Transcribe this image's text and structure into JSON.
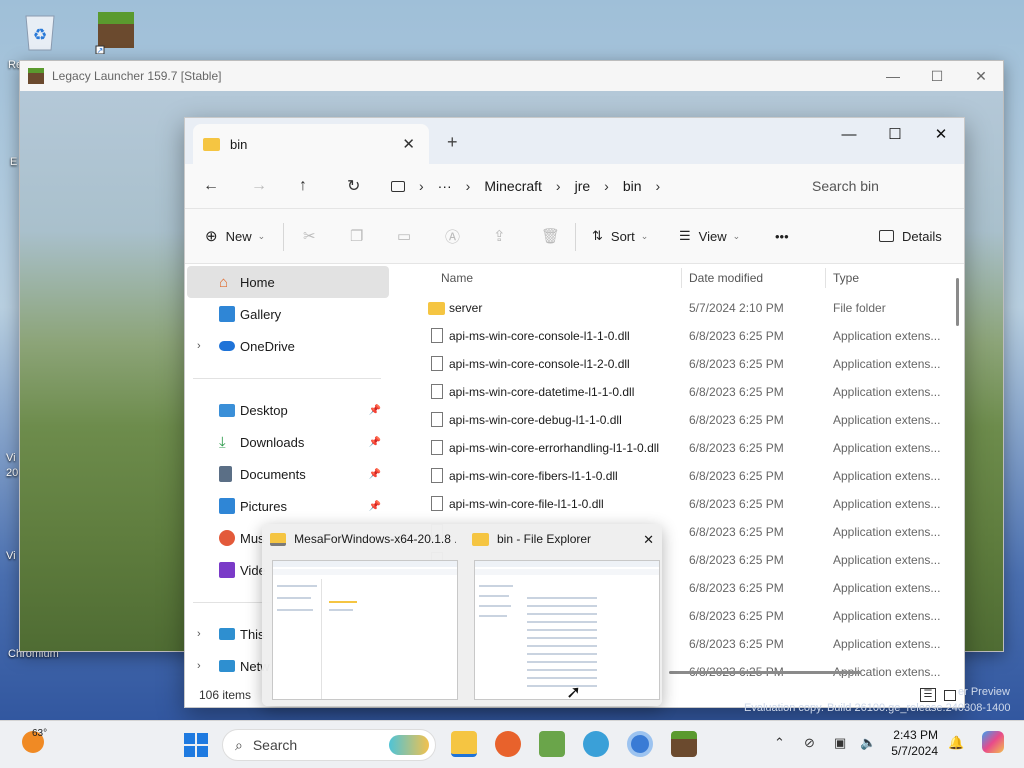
{
  "desktop": {
    "icons": [
      {
        "name": "recycle-bin",
        "label": "Re"
      },
      {
        "name": "minecraft",
        "label": ""
      }
    ],
    "side_labels": [
      "E",
      "Vi",
      "20",
      "Vi",
      "Chromium"
    ]
  },
  "launcher": {
    "title": "Legacy Launcher 159.7 [Stable]"
  },
  "explorer": {
    "tab_title": "bin",
    "breadcrumb": [
      "Minecraft",
      "jre",
      "bin"
    ],
    "search_placeholder": "Search bin",
    "toolbar": {
      "new": "New",
      "sort": "Sort",
      "view": "View",
      "more": "•••",
      "details": "Details"
    },
    "nav": [
      {
        "label": "Home",
        "icon": "home-icon",
        "selected": true
      },
      {
        "label": "Gallery",
        "icon": "gallery-icon"
      },
      {
        "label": "OneDrive",
        "icon": "cloud-icon"
      },
      {
        "label": "Desktop",
        "icon": "desktop-icon"
      },
      {
        "label": "Downloads",
        "icon": "download-icon"
      },
      {
        "label": "Documents",
        "icon": "documents-icon"
      },
      {
        "label": "Pictures",
        "icon": "pictures-icon"
      },
      {
        "label": "Mus",
        "icon": "music-icon"
      },
      {
        "label": "Vide",
        "icon": "video-icon"
      },
      {
        "label": "This",
        "icon": "pc-icon"
      },
      {
        "label": "Netw",
        "icon": "network-icon"
      }
    ],
    "columns": {
      "name": "Name",
      "date": "Date modified",
      "type": "Type"
    },
    "files": [
      {
        "name": "server",
        "date": "5/7/2024 2:10 PM",
        "type": "File folder",
        "folder": true
      },
      {
        "name": "api-ms-win-core-console-l1-1-0.dll",
        "date": "6/8/2023 6:25 PM",
        "type": "Application extens..."
      },
      {
        "name": "api-ms-win-core-console-l1-2-0.dll",
        "date": "6/8/2023 6:25 PM",
        "type": "Application extens..."
      },
      {
        "name": "api-ms-win-core-datetime-l1-1-0.dll",
        "date": "6/8/2023 6:25 PM",
        "type": "Application extens..."
      },
      {
        "name": "api-ms-win-core-debug-l1-1-0.dll",
        "date": "6/8/2023 6:25 PM",
        "type": "Application extens..."
      },
      {
        "name": "api-ms-win-core-errorhandling-l1-1-0.dll",
        "date": "6/8/2023 6:25 PM",
        "type": "Application extens..."
      },
      {
        "name": "api-ms-win-core-fibers-l1-1-0.dll",
        "date": "6/8/2023 6:25 PM",
        "type": "Application extens..."
      },
      {
        "name": "api-ms-win-core-file-l1-1-0.dll",
        "date": "6/8/2023 6:25 PM",
        "type": "Application extens..."
      },
      {
        "name": "",
        "date": "6/8/2023 6:25 PM",
        "type": "Application extens..."
      },
      {
        "name": "",
        "date": "6/8/2023 6:25 PM",
        "type": "Application extens..."
      },
      {
        "name": "",
        "date": "6/8/2023 6:25 PM",
        "type": "Application extens..."
      },
      {
        "name": "",
        "date": "6/8/2023 6:25 PM",
        "type": "Application extens..."
      },
      {
        "name": "",
        "date": "6/8/2023 6:25 PM",
        "type": "Application extens..."
      },
      {
        "name": "",
        "date": "6/8/2023 6:25 PM",
        "type": "Application extens..."
      }
    ],
    "status": "106 items"
  },
  "previews": [
    {
      "title": "MesaForWindows-x64-20.1.8 ...",
      "icon": "zip-folder-icon"
    },
    {
      "title": "bin - File Explorer",
      "icon": "folder-icon"
    }
  ],
  "watermark": {
    "line1": "er Preview",
    "line2": "Evaluation copy. Build 26100.ge_release.240308-1400"
  },
  "taskbar": {
    "temperature": "63°",
    "search": "Search",
    "time": "2:43 PM",
    "date": "5/7/2024"
  }
}
